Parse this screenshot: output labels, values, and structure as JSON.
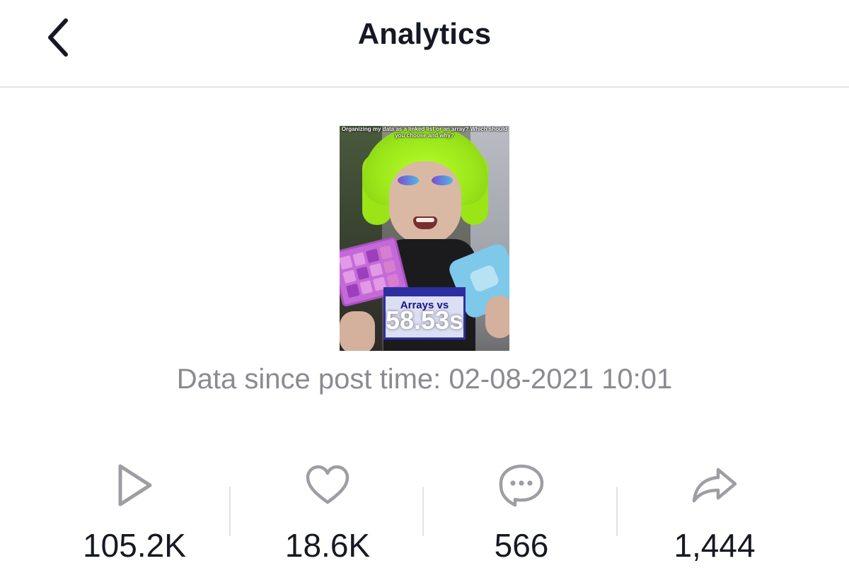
{
  "header": {
    "title": "Analytics",
    "back_icon": "chevron-left-icon"
  },
  "video": {
    "caption": "Organizing my data as a linked list or an array? Which should you choose and why?",
    "sign_text": "Arrays vs",
    "duration": "58.53s"
  },
  "meta": {
    "since_text": "Data since post time: 02-08-2021 10:01"
  },
  "stats": [
    {
      "icon": "play-icon",
      "value": "105.2K"
    },
    {
      "icon": "heart-icon",
      "value": "18.6K"
    },
    {
      "icon": "comment-icon",
      "value": "566"
    },
    {
      "icon": "share-icon",
      "value": "1,444"
    }
  ],
  "colors": {
    "text": "#161823",
    "muted_text": "#8a8b91",
    "icon": "#9d9ea3",
    "divider": "#e3e3e3"
  }
}
